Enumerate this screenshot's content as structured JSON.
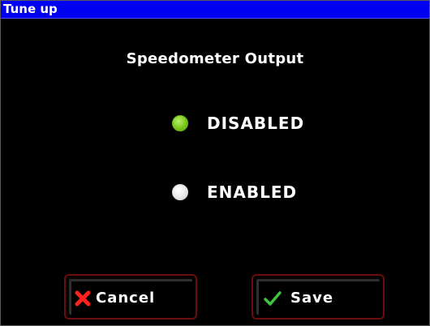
{
  "window": {
    "title": "Tune up"
  },
  "main": {
    "heading": "Speedometer Output",
    "options": [
      {
        "label": "DISABLED",
        "selected": true
      },
      {
        "label": "ENABLED",
        "selected": false
      }
    ]
  },
  "buttons": {
    "cancel_label": "Cancel",
    "save_label": "Save"
  },
  "icons": {
    "cancel": "close-x-icon",
    "save": "checkmark-icon"
  },
  "colors": {
    "titlebar": "#0000f0",
    "background": "#000000",
    "selected_radio": "#7cc81e",
    "unselected_radio": "#e6e6e6",
    "cancel_icon": "#ff2020",
    "save_icon": "#3ec43e",
    "button_border": "#6a0d0d"
  }
}
